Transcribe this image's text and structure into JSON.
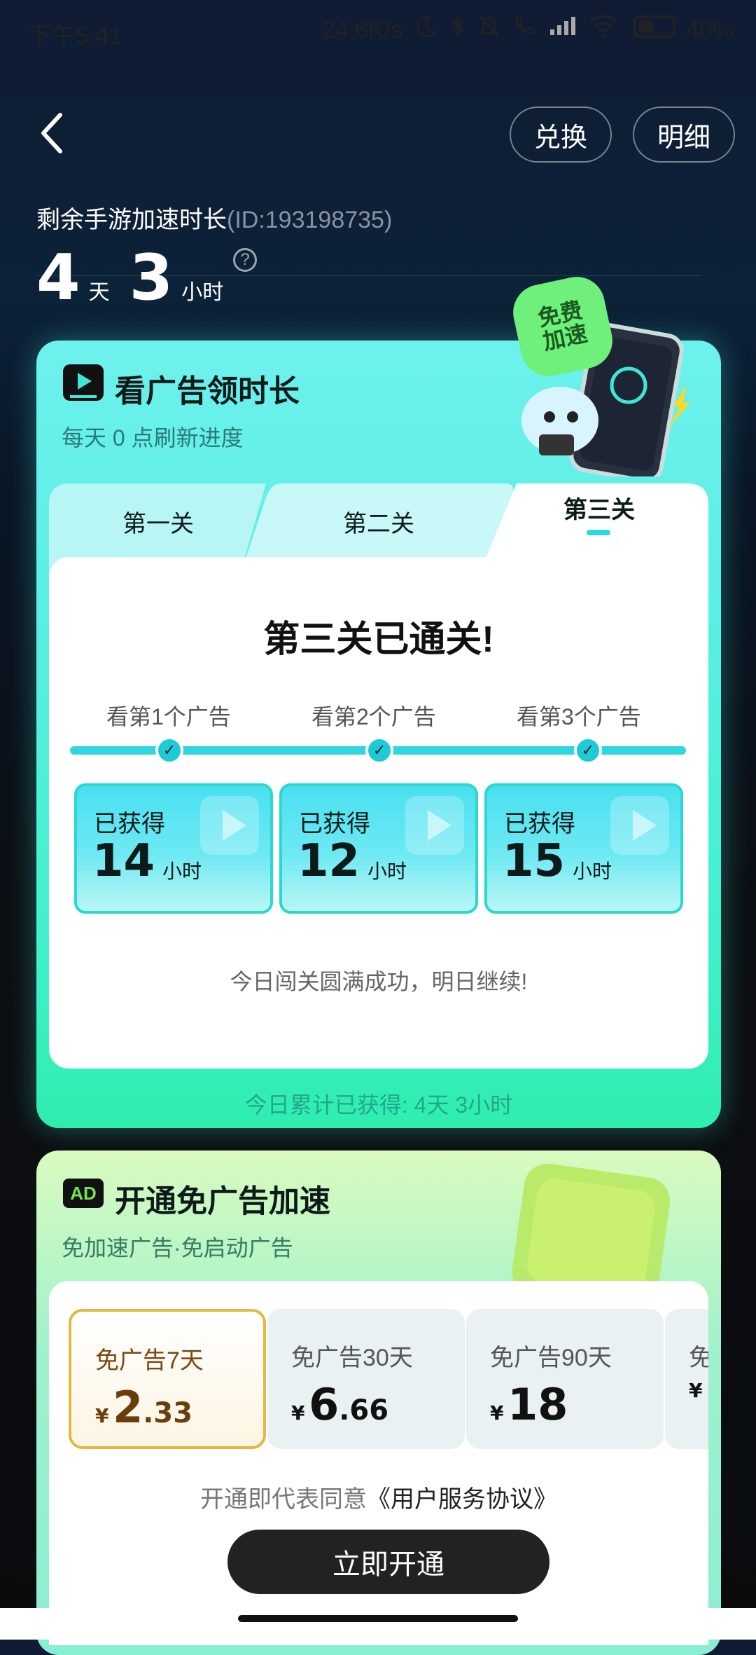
{
  "status_bar": {
    "time": "下午5:41",
    "speed": "24.6K/s",
    "battery": "40%"
  },
  "header": {
    "exchange_label": "兑换",
    "detail_label": "明细"
  },
  "summary": {
    "label": "剩余手游加速时长",
    "id_text": "(ID:193198735)",
    "days": "4",
    "days_unit": "天",
    "hours": "3",
    "hours_unit": "小时",
    "help_glyph": "?"
  },
  "ads_card": {
    "title": "看广告领时长",
    "subtitle": "每天 0 点刷新进度",
    "badge": "免费\n加速",
    "tabs": [
      "第一关",
      "第二关",
      "第三关"
    ],
    "active_tab_index": 2,
    "status_heading": "第三关已通关!",
    "steps": [
      {
        "label": "看第1个广告",
        "reward_label": "已获得",
        "reward_value": "14",
        "reward_unit": "小时"
      },
      {
        "label": "看第2个广告",
        "reward_label": "已获得",
        "reward_value": "12",
        "reward_unit": "小时"
      },
      {
        "label": "看第3个广告",
        "reward_label": "已获得",
        "reward_value": "15",
        "reward_unit": "小时"
      }
    ],
    "complete_message": "今日闯关圆满成功，明日继续!",
    "total_today": "今日累计已获得: 4天 3小时"
  },
  "vip_card": {
    "title": "开通免广告加速",
    "subtitle": "免加速广告·免启动广告",
    "plans": [
      {
        "name": "免广告7天",
        "currency": "¥",
        "price_int": "2",
        "price_dec": ".33",
        "selected": true
      },
      {
        "name": "免广告30天",
        "currency": "¥",
        "price_int": "6",
        "price_dec": ".66",
        "selected": false
      },
      {
        "name": "免广告90天",
        "currency": "¥",
        "price_int": "18",
        "price_dec": "",
        "selected": false
      },
      {
        "name": "免",
        "currency": "¥",
        "price_int": "",
        "price_dec": "",
        "selected": false
      }
    ],
    "agreement_prefix": "开通即代表同意",
    "agreement_link": "《用户服务协议》",
    "cta_label": "立即开通"
  },
  "colors": {
    "accent_cyan": "#2fd6e0",
    "selected_gold": "#e2b93e",
    "cta_bg": "#222222"
  },
  "icons": [
    "back-arrow-icon",
    "moon-icon",
    "bluetooth-icon",
    "mute-icon",
    "call-icon",
    "signal-icon",
    "wifi-icon",
    "battery-icon",
    "tv-play-icon",
    "ad-icon",
    "help-icon",
    "check-icon",
    "play-icon"
  ]
}
